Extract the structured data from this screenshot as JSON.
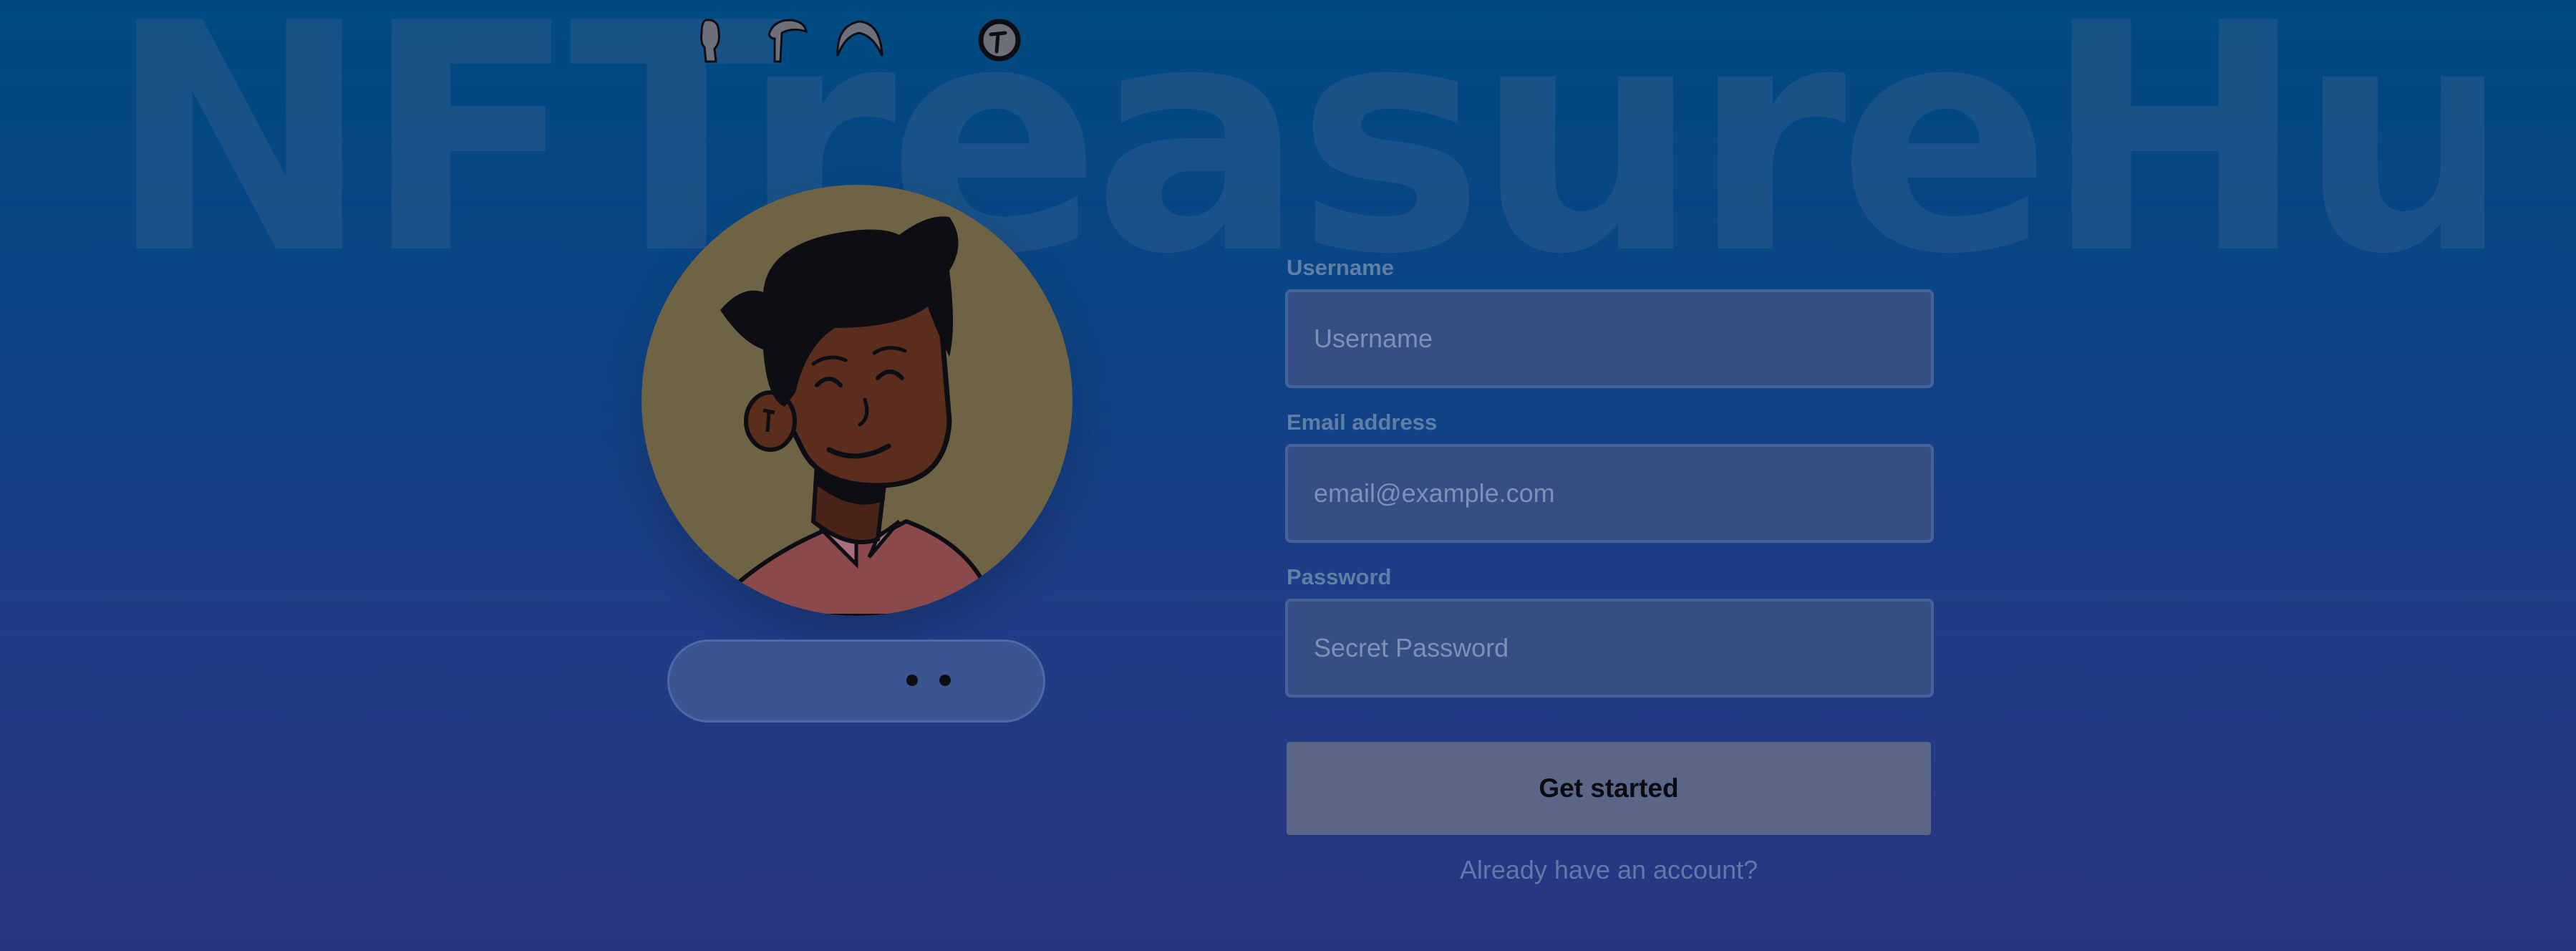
{
  "brand": {
    "watermark_text": "NFTreasureHunt"
  },
  "avatar": {
    "description_icon": "smiling-person-avatar-icon",
    "background_color": "#6e6344",
    "part_picker": {
      "icons": [
        "head-shape-icon",
        "hair-side-icon",
        "hair-round-icon",
        "face-icon"
      ]
    }
  },
  "form": {
    "username": {
      "label": "Username",
      "placeholder": "Username",
      "value": ""
    },
    "email": {
      "label": "Email address",
      "placeholder": "email@example.com",
      "value": ""
    },
    "password": {
      "label": "Password",
      "placeholder": "Secret Password",
      "value": ""
    },
    "submit_label": "Get started",
    "signin_link_label": "Already have an account?"
  },
  "colors": {
    "background_top": "#004a82",
    "background_bottom": "#2a3582",
    "button": "#5b6585",
    "field": "#354f85"
  }
}
